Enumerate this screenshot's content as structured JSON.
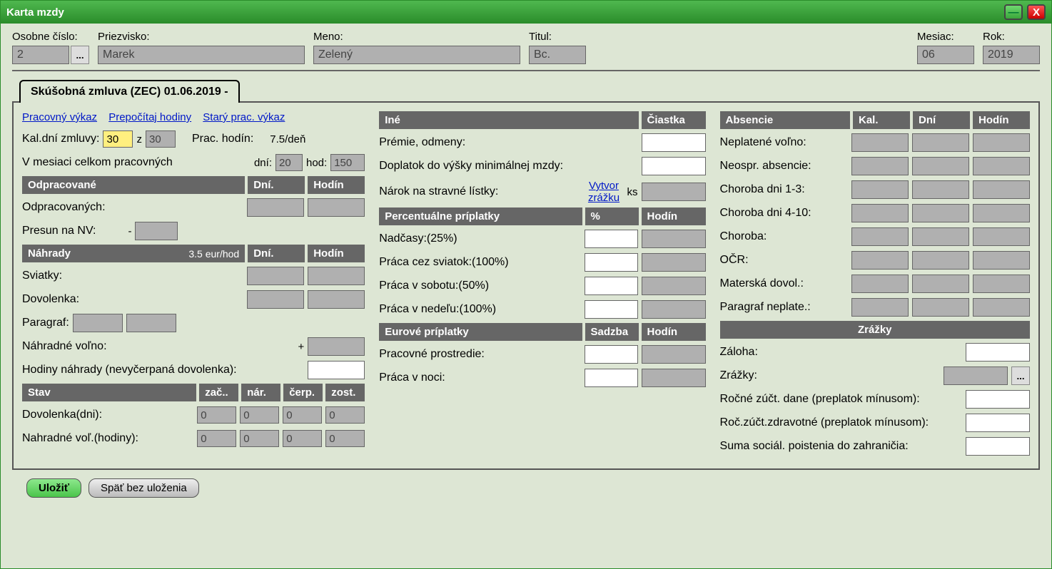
{
  "window": {
    "title": "Karta mzdy"
  },
  "header": {
    "osobne_cislo_label": "Osobne číslo:",
    "osobne_cislo": "2",
    "priezvisko_label": "Priezvisko:",
    "priezvisko": "Marek",
    "meno_label": "Meno:",
    "meno": "Zelený",
    "titul_label": "Titul:",
    "titul": "Bc.",
    "mesiac_label": "Mesiac:",
    "mesiac": "06",
    "rok_label": "Rok:",
    "rok": "2019"
  },
  "tab": {
    "label": "Skúšobná zmluva (ZEC) 01.06.2019 -"
  },
  "links": {
    "pracovny_vykaz": "Pracovný výkaz",
    "prepocitaj": "Prepočítaj hodiny",
    "stary": "Starý prac. výkaz"
  },
  "col1": {
    "kal_dni_label": "Kal.dní zmluvy:",
    "kal_dni_1": "30",
    "z": "z",
    "kal_dni_2": "30",
    "prac_hodin_label": "Prac. hodín:",
    "prac_hodin_val": "7.5/deň",
    "v_mesiaci": "V mesiaci celkom pracovných",
    "dni_label": "dní:",
    "dni_val": "20",
    "hod_label": "hod:",
    "hod_val": "150",
    "odpracovane_hdr": "Odpracované",
    "dni_hdr": "Dní.",
    "hodin_hdr": "Hodín",
    "odpracovanych": "Odpracovaných:",
    "presun_nv": "Presun na NV:",
    "minus": "-",
    "nahrady_hdr": "Náhrady",
    "nahrady_rate": "3.5 eur/hod",
    "sviatky": "Sviatky:",
    "dovolenka": "Dovolenka:",
    "paragraf": "Paragraf:",
    "nahradne_volno": "Náhradné voľno:",
    "plus": "+",
    "hodiny_nahrady": "Hodiny náhrady (nevyčerpaná dovolenka):",
    "stav_hdr": "Stav",
    "zac": "zač..",
    "nar": "nár.",
    "cerp": "čerp.",
    "zost": "zost.",
    "dovolenka_dni": "Dovolenka(dni):",
    "zero": "0",
    "nahradne_vol": "Nahradné voľ.(hodiny):"
  },
  "col2": {
    "ine_hdr": "Iné",
    "ciastka_hdr": "Čiastka",
    "premie": "Prémie, odmeny:",
    "doplatok": "Doplatok do výšky minimálnej mzdy:",
    "narok_listky": "Nárok na stravné lístky:",
    "vytvor": "Vytvor zrážku",
    "ks": "ks",
    "perc_hdr": "Percentuálne príplatky",
    "pct_hdr": "%",
    "hodin_hdr": "Hodín",
    "nadcasy": "Nadčasy:(25%)",
    "sviatok": "Práca cez sviatok:(100%)",
    "sobota": "Práca v sobotu:(50%)",
    "nedela": "Práca v nedeľu:(100%)",
    "euro_hdr": "Eurové príplatky",
    "sadzba_hdr": "Sadzba",
    "prostredie": "Pracovné prostredie:",
    "noc": "Práca v noci:"
  },
  "col3": {
    "absencie_hdr": "Absencie",
    "kal_hdr": "Kal.",
    "dni_hdr": "Dní",
    "hodin_hdr": "Hodín",
    "neplat": "Neplatené voľno:",
    "neospr": "Neospr. absencie:",
    "choroba13": "Choroba dni 1-3:",
    "choroba410": "Choroba dni 4-10:",
    "choroba": "Choroba:",
    "ocr": "OČR:",
    "materska": "Materská dovol.:",
    "paragraf_neplat": "Paragraf neplate.:",
    "zrazky_hdr": "Zrážky",
    "zaloha": "Záloha:",
    "zrazky": "Zrážky:",
    "rocne_dane": "Ročné zúčt. dane (preplatok mínusom):",
    "roc_zdrav": "Roč.zúčt.zdravotné (preplatok mínusom):",
    "suma_soc": "Suma sociál. poistenia do zahraničia:"
  },
  "buttons": {
    "ulozit": "Uložiť",
    "spat": "Späť bez uloženia"
  }
}
